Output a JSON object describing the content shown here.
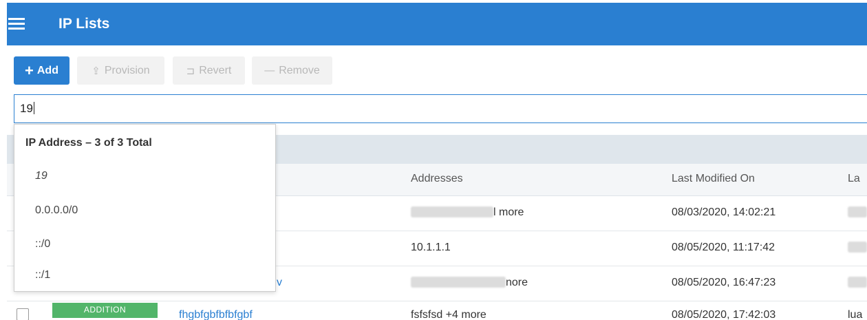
{
  "header": {
    "title": "IP Lists",
    "menu_icon": "hamburger-menu-icon"
  },
  "toolbar": {
    "add_label": "Add",
    "provision_label": "Provision",
    "revert_label": "Revert",
    "remove_label": "Remove"
  },
  "search": {
    "value": "19"
  },
  "dropdown": {
    "header": "IP Address – 3 of 3 Total",
    "items": [
      "19",
      "0.0.0.0/0",
      "::/0",
      "::/1"
    ]
  },
  "table": {
    "columns": {
      "addresses": "Addresses",
      "last_modified_on": "Last Modified On",
      "last_modified_by": "La"
    },
    "rows": [
      {
        "addresses_suffix": "l more",
        "modified_on": "08/03/2020, 14:02:21"
      },
      {
        "addresses": "10.1.1.1",
        "modified_on": "08/05/2020, 11:17:42"
      },
      {
        "name_suffix": "v",
        "addresses_suffix": "nore",
        "modified_on": "08/05/2020, 16:47:23"
      },
      {
        "status": "ADDITION",
        "name": "fhgbfgbfbfbfgbf",
        "addresses": "fsfsfsd +4 more",
        "modified_on": "08/05/2020, 17:42:03",
        "modified_by": "lua"
      }
    ]
  },
  "colors": {
    "brand": "#2a7fd1",
    "addition_badge": "#52b56a"
  }
}
